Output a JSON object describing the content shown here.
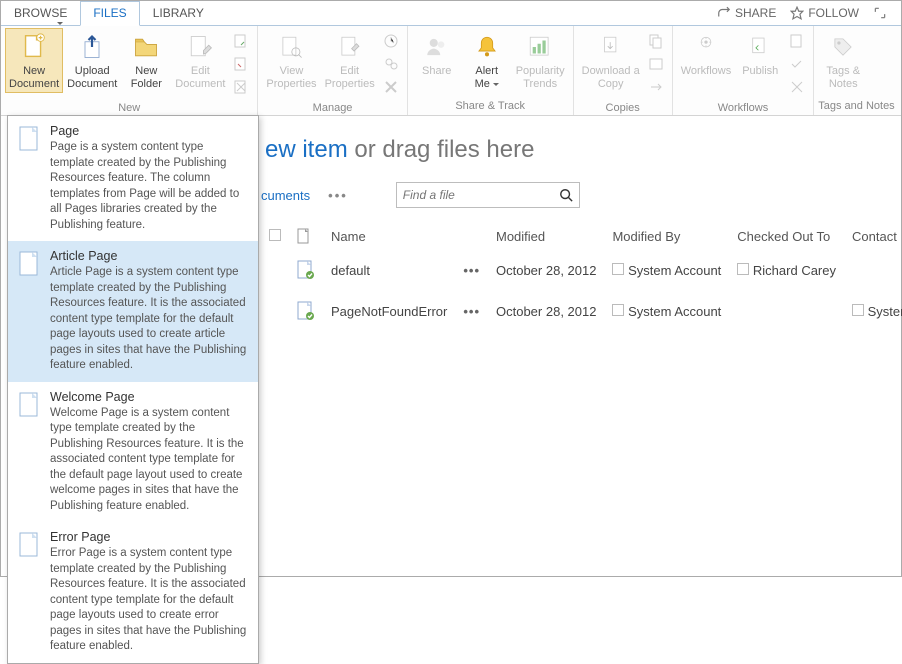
{
  "tabs": {
    "browse": "BROWSE",
    "files": "FILES",
    "library": "LIBRARY"
  },
  "topright": {
    "share": "SHARE",
    "follow": "FOLLOW"
  },
  "ribbon": {
    "new_document": "New\nDocument",
    "upload_document": "Upload\nDocument",
    "new_folder": "New\nFolder",
    "edit_document": "Edit\nDocument",
    "group_new": "New",
    "view_properties": "View\nProperties",
    "edit_properties": "Edit\nProperties",
    "group_manage": "Manage",
    "share": "Share",
    "alert_me": "Alert\nMe",
    "popularity_trends": "Popularity\nTrends",
    "group_sharetrack": "Share & Track",
    "download_copy": "Download a\nCopy",
    "group_copies": "Copies",
    "workflows": "Workflows",
    "publish": "Publish",
    "group_workflows": "Workflows",
    "tags_notes": "Tags &\nNotes",
    "group_tags": "Tags and Notes"
  },
  "content": {
    "newitem_prefix": "ew item",
    "newitem_rest": " or drag files here",
    "toolbar_link": "cuments",
    "search_placeholder": "Find a file"
  },
  "columns": {
    "type": "",
    "name": "Name",
    "modified": "Modified",
    "modifiedby": "Modified By",
    "checkedout": "Checked Out To",
    "contact": "Contact"
  },
  "rows": [
    {
      "name": "default",
      "modified": "October 28, 2012",
      "modifiedby": "System Account",
      "checkedout": "Richard Carey",
      "contact": ""
    },
    {
      "name": "PageNotFoundError",
      "modified": "October 28, 2012",
      "modifiedby": "System Account",
      "checkedout": "",
      "contact": "System Accou"
    }
  ],
  "dropdown": [
    {
      "title": "Page",
      "desc": "Page is a system content type template created by the Publishing Resources feature. The column templates from Page will be added to all Pages libraries created by the Publishing feature."
    },
    {
      "title": "Article Page",
      "desc": "Article Page is a system content type template created by the Publishing Resources feature. It is the associated content type template for the default page layouts used to create article pages in sites that have the Publishing feature enabled."
    },
    {
      "title": "Welcome Page",
      "desc": "Welcome Page is a system content type template created by the Publishing Resources feature. It is the associated content type template for the default page layout used to create welcome pages in sites that have the Publishing feature enabled."
    },
    {
      "title": "Error Page",
      "desc": "Error Page is a system content type template created by the Publishing Resources feature. It is the associated content type template for the default page layouts used to create error pages in sites that have the Publishing feature enabled."
    }
  ]
}
